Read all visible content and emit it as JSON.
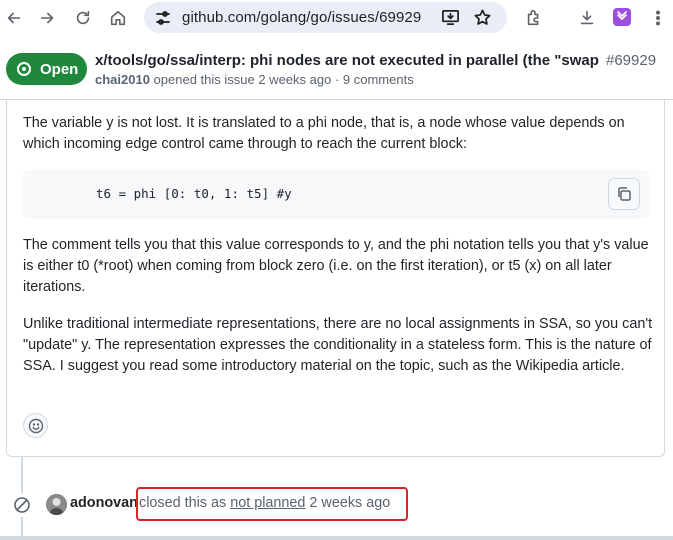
{
  "browser": {
    "url": "github.com/golang/go/issues/69929"
  },
  "issue": {
    "state": "Open",
    "title": "x/tools/go/ssa/interp: phi nodes are not executed in parallel (the \"swap pr...",
    "number": "#69929",
    "author": "chai2010",
    "meta_rest": " opened this issue 2 weeks ago · 9 comments"
  },
  "comment": {
    "p1": "The variable y is not lost. It is translated to a phi node, that is, a node whose value depends on which incoming edge control came through to reach the current block:",
    "code": "t6 = phi [0: t0, 1: t5] #y",
    "p2": "The comment tells you that this value corresponds to y, and the phi notation tells you that y's value is either t0 (*root) when coming from block zero (i.e. on the first iteration), or t5 (x) on all later iterations.",
    "p3": "Unlike traditional intermediate representations, there are no local assignments in SSA, so you can't \"update\" y. The representation expresses the conditionality in a stateless form. This is the nature of SSA. I suggest you read some introductory material on the topic, such as the Wikipedia article."
  },
  "event": {
    "actor": "adonovan",
    "text_before": "closed this as ",
    "reason": "not planned",
    "text_after": " 2 weeks ago"
  },
  "colors": {
    "open_green": "#1f883d",
    "highlight_red": "#d62828",
    "omnibox_bg": "#e9eef6"
  },
  "icons": [
    "back-arrow-icon",
    "forward-arrow-icon",
    "reload-icon",
    "home-icon",
    "site-settings-icon",
    "install-app-icon",
    "bookmark-star-icon",
    "extensions-icon",
    "download-icon",
    "extension-purple-icon",
    "menu-kebab-icon",
    "copy-icon",
    "smiley-icon",
    "skip-circle-icon"
  ]
}
